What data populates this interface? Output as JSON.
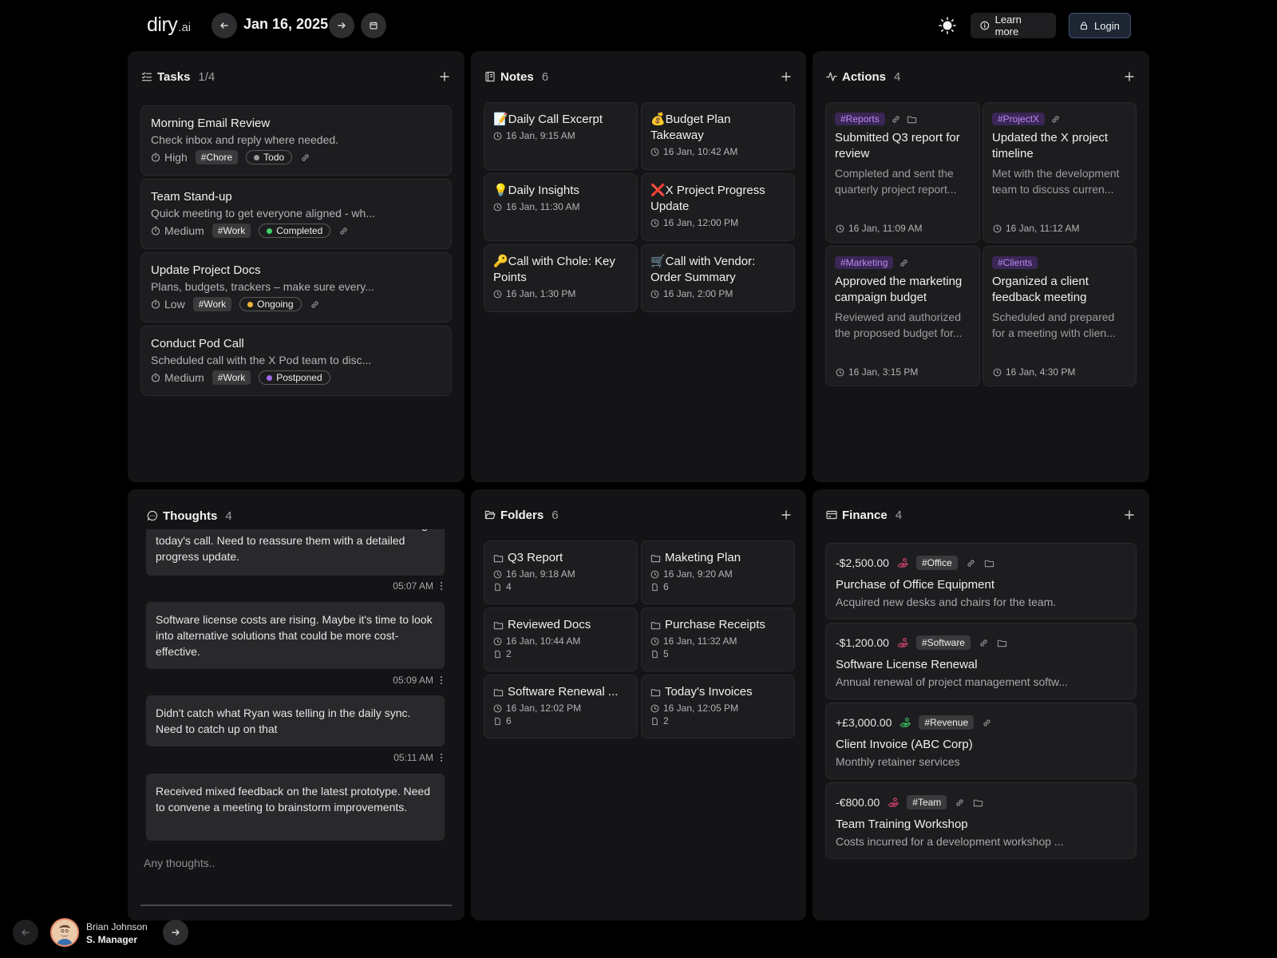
{
  "header": {
    "logo_main": "diry",
    "logo_suffix": ".ai",
    "date": "Jan 16, 2025",
    "learn_more": "Learn more",
    "login": "Login"
  },
  "tasks": {
    "title": "Tasks",
    "count": "1/4",
    "items": [
      {
        "title": "Morning Email Review",
        "desc": "Check inbox and reply where needed.",
        "priority": "High",
        "tag": "#Chore",
        "status": "Todo",
        "status_color": "#9a9a9d"
      },
      {
        "title": "Team Stand-up",
        "desc": "Quick meeting to get everyone aligned - wh...",
        "priority": "Medium",
        "tag": "#Work",
        "status": "Completed",
        "status_color": "#3ecf6a"
      },
      {
        "title": "Update Project Docs",
        "desc": "Plans, budgets, trackers – make sure every...",
        "priority": "Low",
        "tag": "#Work",
        "status": "Ongoing",
        "status_color": "#f0b43a"
      },
      {
        "title": "Conduct Pod Call",
        "desc": "Scheduled call with the X Pod team to disc...",
        "priority": "Medium",
        "tag": "#Work",
        "status": "Postponed",
        "status_color": "#a06ae8"
      }
    ]
  },
  "notes": {
    "title": "Notes",
    "count": "6",
    "items": [
      {
        "title": "📝Daily Call Excerpt",
        "time": "16 Jan, 9:15 AM"
      },
      {
        "title": "💰Budget Plan Takeaway",
        "time": "16 Jan, 10:42 AM"
      },
      {
        "title": "💡Daily Insights",
        "time": "16 Jan, 11:30 AM"
      },
      {
        "title": "❌X Project Progress Update",
        "time": "16 Jan, 12:00 PM"
      },
      {
        "title": "🔑Call with Chole: Key Points",
        "time": "16 Jan, 1:30 PM"
      },
      {
        "title": "🛒Call with Vendor: Order Summary",
        "time": "16 Jan, 2:00 PM"
      }
    ]
  },
  "actions": {
    "title": "Actions",
    "count": "4",
    "items": [
      {
        "tag": "#Reports",
        "title": "Submitted Q3 report for review",
        "desc": "Completed and sent the quarterly project report...",
        "time": "16 Jan, 11:09 AM"
      },
      {
        "tag": "#ProjectX",
        "title": "Updated the X project timeline",
        "desc": "Met with the development team to discuss curren...",
        "time": "16 Jan, 11:12 AM"
      },
      {
        "tag": "#Marketing",
        "title": "Approved the marketing campaign budget",
        "desc": "Reviewed and authorized the proposed budget for...",
        "time": "16 Jan, 3:15 PM"
      },
      {
        "tag": "#Clients",
        "title": "Organized a client feedback meeting",
        "desc": "Scheduled and prepared for a meeting with clien...",
        "time": "16 Jan, 4:30 PM"
      }
    ]
  },
  "thoughts": {
    "title": "Thoughts",
    "count": "4",
    "items": [
      {
        "text": "The client seemed concerned about the timeline during today's call. Need to reassure them with a detailed progress update.",
        "time": "05:07 AM"
      },
      {
        "text": "Software license costs are rising. Maybe it's time to look into alternative solutions that could be more cost-effective.",
        "time": "05:09 AM"
      },
      {
        "text": "Didn't catch what Ryan was telling in the daily sync. Need to catch up on that",
        "time": "05:11 AM"
      },
      {
        "text": "Received mixed feedback on the latest prototype. Need to convene a meeting to brainstorm improvements.",
        "time": ""
      }
    ],
    "placeholder": "Any thoughts.."
  },
  "folders": {
    "title": "Folders",
    "count": "6",
    "items": [
      {
        "name": "Q3 Report",
        "time": "16 Jan, 9:18 AM",
        "files": "4"
      },
      {
        "name": "Maketing Plan",
        "time": "16 Jan, 9:20 AM",
        "files": "6"
      },
      {
        "name": "Reviewed Docs",
        "time": "16 Jan, 10:44 AM",
        "files": "2"
      },
      {
        "name": "Purchase Receipts",
        "time": "16 Jan, 11:32 AM",
        "files": "5"
      },
      {
        "name": "Software Renewal ...",
        "time": "16 Jan, 12:02 PM",
        "files": "6"
      },
      {
        "name": "Today's Invoices",
        "time": "16 Jan, 12:05 PM",
        "files": "2"
      }
    ]
  },
  "finance": {
    "title": "Finance",
    "count": "4",
    "items": [
      {
        "amount": "-$2,500.00",
        "direction": "out",
        "tag": "#Office",
        "title": "Purchase of Office Equipment",
        "desc": "Acquired new desks and chairs for the team."
      },
      {
        "amount": "-$1,200.00",
        "direction": "out",
        "tag": "#Software",
        "title": "Software License Renewal",
        "desc": "Annual renewal of project management softw..."
      },
      {
        "amount": "+£3,000.00",
        "direction": "in",
        "tag": "#Revenue",
        "title": "Client Invoice (ABC Corp)",
        "desc": "Monthly retainer services"
      },
      {
        "amount": "-€800.00",
        "direction": "out",
        "tag": "#Team",
        "title": "Team Training Workshop",
        "desc": "Costs incurred for a development workshop ..."
      }
    ]
  },
  "user": {
    "name": "Brian Johnson",
    "role": "S. Manager"
  },
  "colors": {
    "background": "#000000",
    "panel": "#141416",
    "card": "#1d1d1f",
    "tag_purple_bg": "#3b2656",
    "tag_purple_text": "#b58cf0",
    "expense_red": "#e0457a",
    "income_green": "#3ecf6a"
  }
}
